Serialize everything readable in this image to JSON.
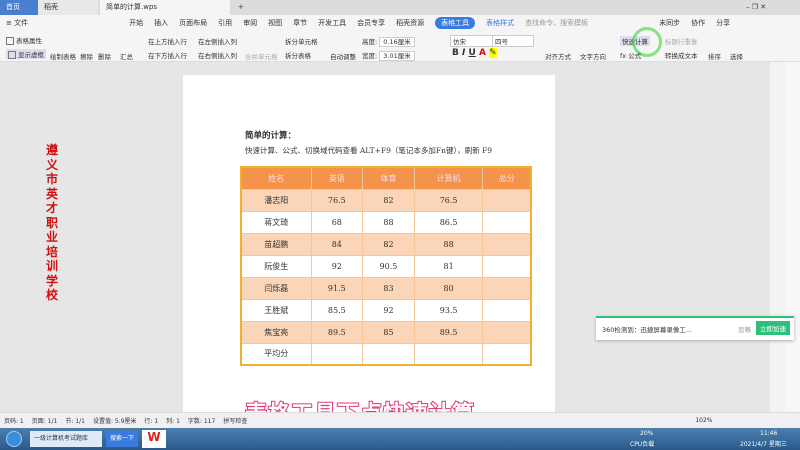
{
  "tabs": [
    {
      "label": "首页"
    },
    {
      "label": "稻壳"
    },
    {
      "label": "简单的计算.wps"
    }
  ],
  "menu": [
    "≡ 文件",
    "开始",
    "插入",
    "页面布局",
    "引用",
    "审阅",
    "视图",
    "章节",
    "开发工具",
    "会员专享",
    "稻壳资源",
    "表格工具",
    "表格样式"
  ],
  "search_placeholder": "查找命令、搜索模板",
  "right_actions": [
    "未同步",
    "协作",
    "分享"
  ],
  "ribbon": {
    "b1": "表格属性",
    "b2": "显示虚框",
    "draw": "绘制表格",
    "erase": "擦除",
    "delete": "删除",
    "sum": "汇总",
    "ins_above": "在上方插入行",
    "ins_below": "在下方插入行",
    "ins_left": "在左侧插入列",
    "ins_right": "在右侧插入列",
    "merge": "合并单元格",
    "split_cell": "拆分单元格",
    "split_table": "拆分表格",
    "autofit": "自动调整",
    "height_label": "高度:",
    "height": "0.16厘米",
    "width_label": "宽度:",
    "width": "3.01厘米",
    "font": "仿宋",
    "size": "四号",
    "align": "对齐方式",
    "direction": "文字方向",
    "quick_calc": "快速计算",
    "formula": "fx 公式",
    "repeat_header": "标题行重复",
    "to_text": "转换成文本",
    "sort": "排序",
    "select": "选择"
  },
  "sidebar_text": "遵义市英才职业培训学校",
  "doc": {
    "heading": "简单的计算：",
    "desc": "快速计算、公式、切换域代码查看 ALT+F9（笔记本多加Fn键），刷新 F9"
  },
  "table": {
    "headers": [
      "姓名",
      "英语",
      "体育",
      "计算机",
      "总分"
    ],
    "rows": [
      [
        "潘志阳",
        "76.5",
        "82",
        "76.5",
        ""
      ],
      [
        "蒋文琦",
        "68",
        "88",
        "86.5",
        ""
      ],
      [
        "苗超鹏",
        "84",
        "82",
        "88",
        ""
      ],
      [
        "阮俊生",
        "92",
        "90.5",
        "81",
        ""
      ],
      [
        "闫烁磊",
        "91.5",
        "83",
        "80",
        ""
      ],
      [
        "王胜斌",
        "85.5",
        "92",
        "93.5",
        ""
      ],
      [
        "焦宝亮",
        "89.5",
        "85",
        "89.5",
        ""
      ],
      [
        "平均分",
        "",
        "",
        "",
        ""
      ]
    ]
  },
  "caption": "表格工具下点快速计算",
  "notification": {
    "text": "360检测到：迅捷屏幕录像工...",
    "ignore": "忽略",
    "action": "立即加速"
  },
  "status": [
    "页码: 1",
    "页面: 1/1",
    "节: 1/1",
    "设置值: 5.9厘米",
    "行: 1",
    "列: 1",
    "字数: 117",
    "拼写检查"
  ],
  "zoom": "102%",
  "taskbar": {
    "browser": "一级计算机考试题库",
    "search": "搜索一下",
    "cpu": "20%",
    "cpu_label": "CPU负载",
    "time": "11:46",
    "date": "2021/4/7 星期三"
  },
  "colors": {
    "header": "#f4934a",
    "odd_row": "#fbd5b7",
    "accent": "#2cc07a"
  }
}
